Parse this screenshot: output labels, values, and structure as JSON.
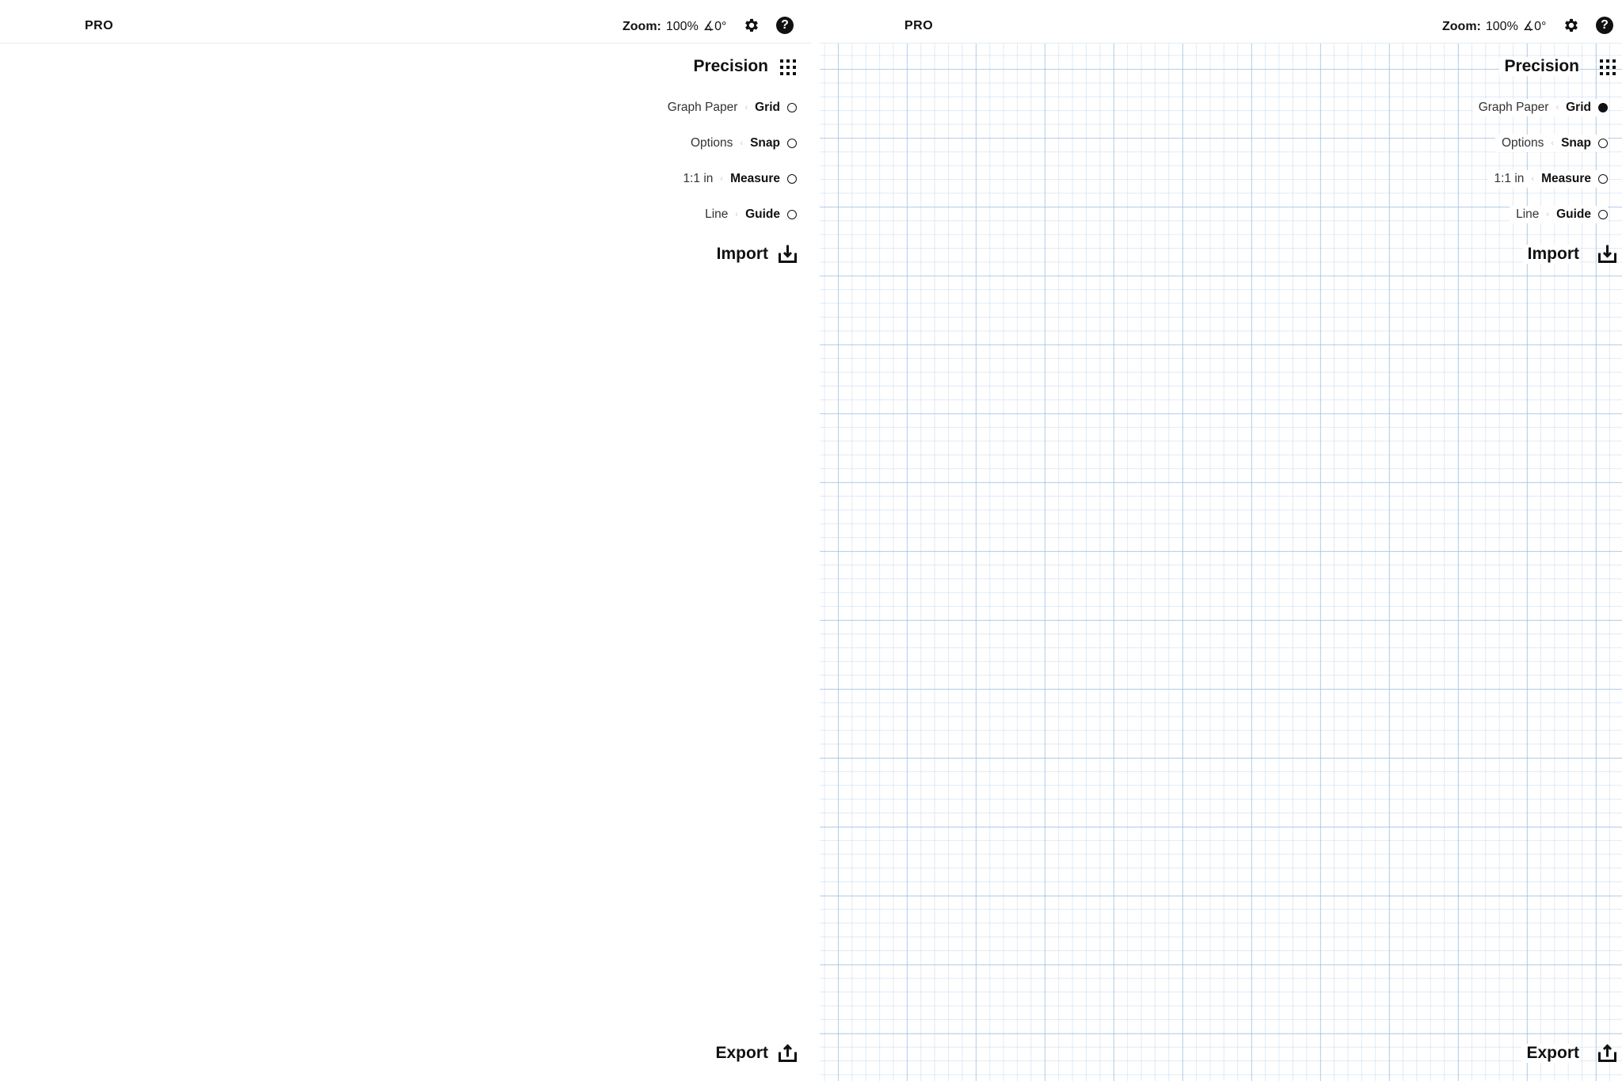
{
  "screens": [
    {
      "brand": "PRO",
      "zoom": {
        "label": "Zoom:",
        "value": "100%",
        "angle": "∡0°"
      },
      "panel": {
        "title": "Precision",
        "options": [
          {
            "sub": "Graph Paper",
            "name": "Grid",
            "selected": false
          },
          {
            "sub": "Options",
            "name": "Snap",
            "selected": false
          },
          {
            "sub": "1:1 in",
            "name": "Measure",
            "selected": false
          },
          {
            "sub": "Line",
            "name": "Guide",
            "selected": false
          }
        ],
        "import_label": "Import",
        "export_label": "Export"
      },
      "graph_paper_visible": false
    },
    {
      "brand": "PRO",
      "zoom": {
        "label": "Zoom:",
        "value": "100%",
        "angle": "∡0°"
      },
      "panel": {
        "title": "Precision",
        "options": [
          {
            "sub": "Graph Paper",
            "name": "Grid",
            "selected": true
          },
          {
            "sub": "Options",
            "name": "Snap",
            "selected": false
          },
          {
            "sub": "1:1 in",
            "name": "Measure",
            "selected": false
          },
          {
            "sub": "Line",
            "name": "Guide",
            "selected": false
          }
        ],
        "import_label": "Import",
        "export_label": "Export"
      },
      "graph_paper_visible": true
    }
  ],
  "icons": {
    "settings": "gear-icon",
    "help": "help-icon",
    "precision": "dots-grid-icon",
    "import": "download-tray-icon",
    "export": "upload-tray-icon"
  },
  "colors": {
    "grid_major": "#96b9dc",
    "grid_minor": "#b9d2eb",
    "text": "#111111"
  }
}
